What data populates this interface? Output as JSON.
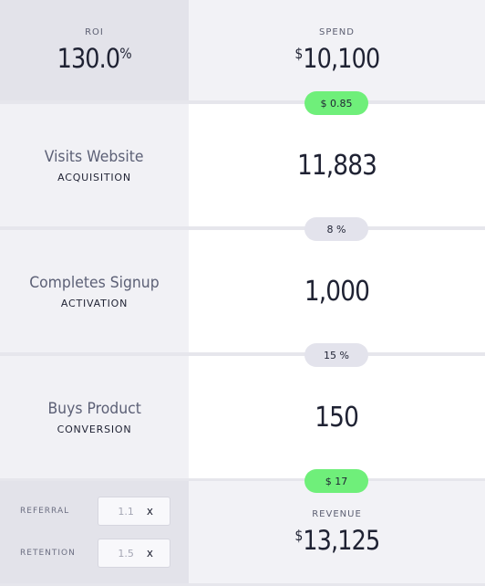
{
  "top": {
    "roi_label": "ROI",
    "roi_value": "130.0",
    "roi_unit": "%",
    "spend_label": "SPEND",
    "spend_symbol": "$",
    "spend_value": "10,100"
  },
  "stages": [
    {
      "title": "Visits Website",
      "subtitle": "ACQUISITION",
      "value": "11,883"
    },
    {
      "title": "Completes Signup",
      "subtitle": "ACTIVATION",
      "value": "1,000"
    },
    {
      "title": "Buys Product",
      "subtitle": "CONVERSION",
      "value": "150"
    }
  ],
  "pills": [
    {
      "text": "$ 0.85",
      "color": "#6fef7a"
    },
    {
      "text": "8 %",
      "color": "#e3e3ec"
    },
    {
      "text": "15 %",
      "color": "#e3e3ec"
    },
    {
      "text": "$ 17",
      "color": "#6fef7a"
    }
  ],
  "bottom": {
    "referral_label": "REFERRAL",
    "referral_value": "1.1",
    "retention_label": "RETENTION",
    "retention_value": "1.5",
    "multiplier_symbol": "x",
    "revenue_label": "REVENUE",
    "revenue_symbol": "$",
    "revenue_value": "13,125"
  }
}
